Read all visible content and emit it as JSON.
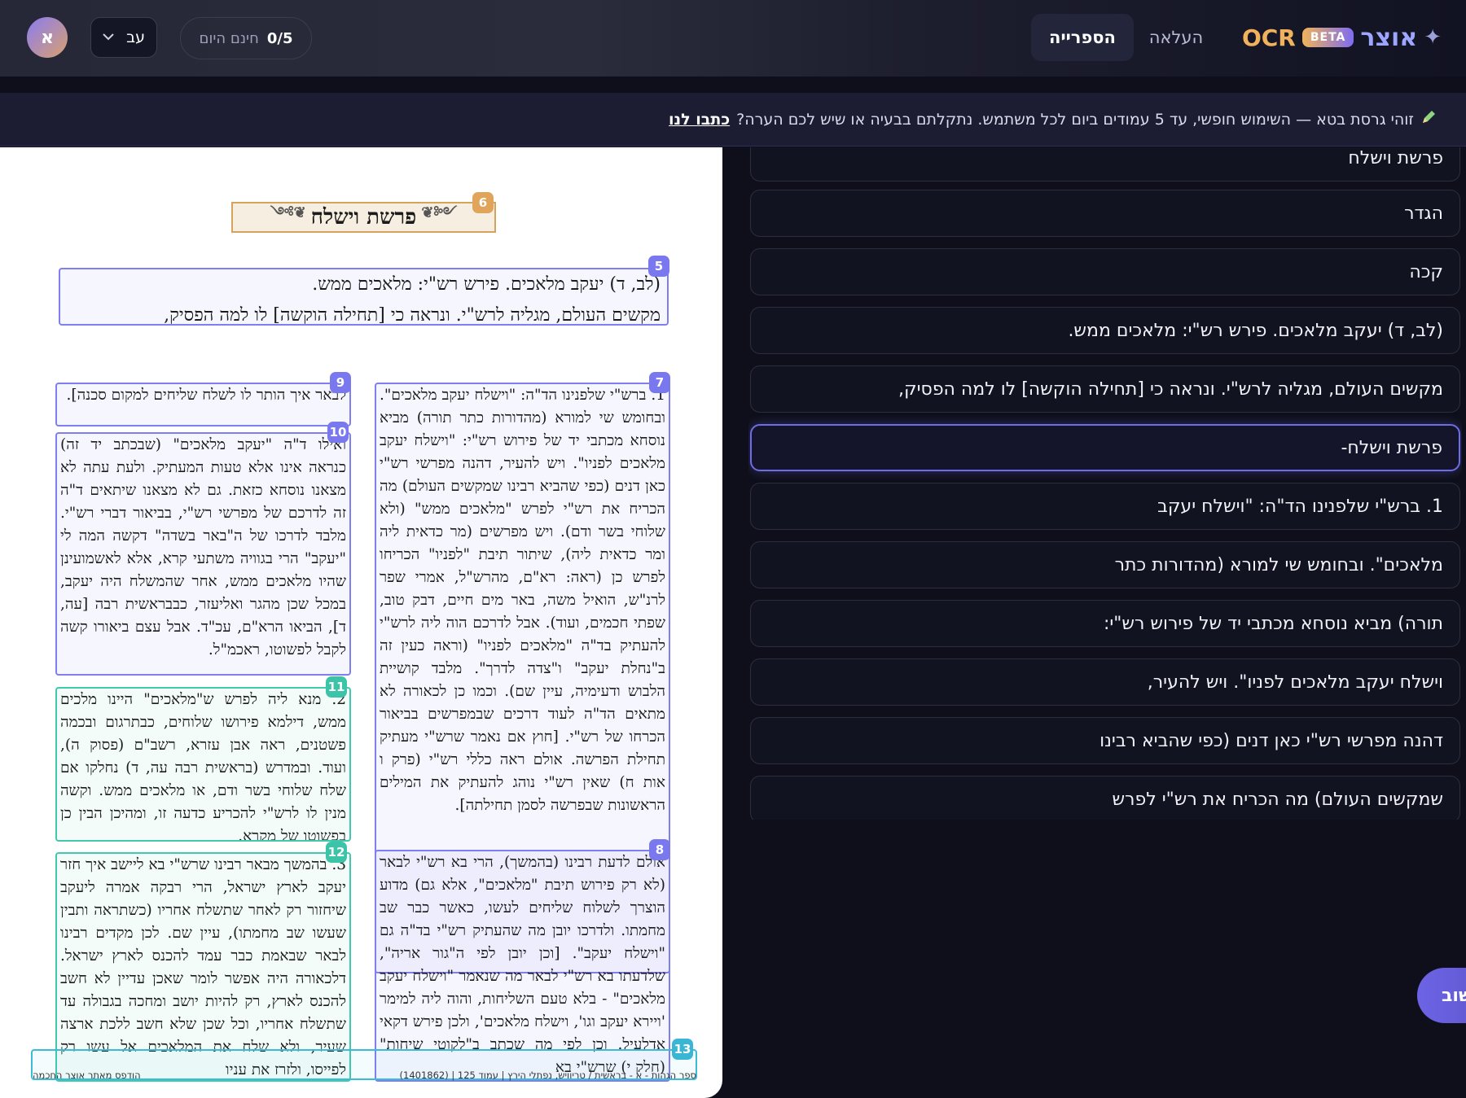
{
  "header": {
    "brand_spark": "✦",
    "brand_hebrew": "אוצר",
    "brand_beta": "BETA",
    "brand_ocr": "OCR",
    "tab_library": "הספרייה",
    "tab_upload": "העלאה",
    "quota_value": "0/5",
    "quota_label": "חינם היום",
    "language_value": "עב",
    "avatar_letter": "א"
  },
  "banner": {
    "text": "זוהי גרסת בטא — השימוש חופשי, עד 5 עמודים ביום לכל משתמש. נתקלתם בבעיה או שיש לכם הערה?",
    "link": "כתבו לנו"
  },
  "document": {
    "title": "פרשת וישלח",
    "intro_lines": [
      "(לב, ד) יעקב מלאכים. פירש רש\"י: מלאכים ממש.",
      "מקשים העולם, מגליה לרש\"י. ונראה כי [תחילה הוקשה] לו למה הפסיק,"
    ],
    "zones": {
      "z5": "5",
      "z6": "6",
      "z7": "7",
      "z8": "8",
      "z9": "9",
      "z10": "10",
      "z11": "11",
      "z12": "12",
      "z13": "13"
    },
    "col_right_top": "1. ברש\"י שלפנינו הד\"ה: \"וישלח יעקב מלאכים\". ובחומש שי למורא (מהדורות כתר תורה) מביא נוסחא מכתבי יד של פירוש רש\"י: \"וישלח יעקב מלאכים לפניו\". ויש להעיר, דהנה מפרשי רש\"י כאן דנים (כפי שהביא רבינו שמקשים העולם) מה הכריח את רש\"י לפרש \"מלאכים ממש\" (ולא שלוחי בשר ודם). ויש מפרשים (מר כדאית ליה ומר כדאית ליה), שיתור תיבת \"לפניו\" הכריחו לפרש כן (ראה: רא\"ם, מהרש\"ל, אמרי שפר לרנ\"ש, הואיל משה, באר מים חיים, דבק טוב, שפתי חכמים, ועוד). אבל לדרכם הוה ליה לרש\"י להעתיק בד\"ה \"מלאכים לפניו\" (וראה כעין זה ב\"נחלת יעקב\" ו\"צדה לדרך\". מלבד קושיית הלבוש ודעימיה, עיין שם). וכמו כן לכאורה לא מתאים הד\"ה לעוד דרכים שבמפרשים בביאור הכרחו של רש\"י. [חוץ אם נאמר שרש\"י מעתיק תחילת הפרשה. אולם ראה כללי רש\"י (פרק ו אות ח) שאין רש\"י נוהג להעתיק את המילים הראשונות שבפרשה לסמן תחילתה].",
    "col_right_bottom": "אולם לדעת רבינו (בהמשך), הרי בא רש\"י לבאר (לא רק פירוש תיבת \"מלאכים\", אלא גם) מדוע הוצרך לשלוח שליחים לעשו, כאשר כבר שב מחמתו. ולדרכו יובן מה שהעתיק רש\"י בד\"ה גם \"וישלח יעקב\". [וכן יובן לפי ה\"גור אריה\", שלדעתו בא רש\"י לבאר מה שנאמר \"וישלח יעקב מלאכים\" - בלא טעם השליחות, והוה ליה למימר 'ויירא יעקב וגו', וישלח מלאכים', ולכן פירש דקאי אדלעיל. וכן לפי מה שכתב ב\"לקוטי שיחות\" (חלק י) שרש\"י בא",
    "col_left_9": "לבאר איך הותר לו לשלח שליחים למקום סכנה].",
    "col_left_10": "ואילו ד\"ה \"יעקב מלאכים\" (שבכתב יד זה) כנראה אינו אלא טעות המעתיק. ולעת עתה לא מצאנו נוסחא כזאת. גם לא מצאנו שיתאים ד\"ה זה לדרכם של מפרשי רש\"י, בביאור דברי רש\"י. מלבד לדרכו של ה\"באר בשדה\" דקשה המה לי \"יעקב\" הרי בגוויה משתעי קרא, אלא לאשמועינן שהיו מלאכים ממש, אחר שהמשלח היה יעקב, במכל שכן מהגר ואליעזר, כבבראשית רבה [עה, ד], הביאו הרא\"ם, עכ\"ד. אבל עצם ביאורו קשה לקבל לפשוטו, ראכמ\"ל.",
    "col_left_11": "2. מנא ליה לפרש ש\"מלאכים\" היינו מלכים ממש, דילמא פירושו שלוחים, כבתרגום ובכמה פשטנים, ראה אבן עזרא, רשב\"ם (פסוק ה), ועוד. ובמדרש (בראשית רבה עה, ד) נחלקו אם שלח שלוחי בשר ודם, או מלאכים ממש. וקשה מנין לו לרש\"י להכריע כדעה זו, ומהיכן הבין כן בפשוטו של מקרא.",
    "col_left_12": "3. בהמשך מבאר רבינו שרש\"י בא ליישב איך חזר יעקב לארץ ישראל, הרי רבקה אמרה ליעקב שיחזור רק לאחר שתשלח אחריו (כשתראה ותבין שעשו שב מחמתו), עיין שם. לכן מקדים רבינו לבאר שבאמת כבר עמד להכנס לארץ ישראל. דלכאורה היה אפשר לומר שאכן עדיין לא חשב להכנס לארץ, רק להיות יושב ומחכה בגבולה עד שתשלח אחריו, וכל שכן שלא חשב ללכת ארצה שעיר, ולא שלח את המלאכים אל עשו רק לפייסו, ולזרז את עניו",
    "footer_right": "ספר הגהות - א - בראשית / טריוויש, נפתלי הירץ | עמוד 125 | (1401862)",
    "footer_left": "הודפס מאתר אוצר החכמה"
  },
  "panel": {
    "lines": [
      "פרשת וישלח",
      "הגדר",
      "קכה",
      "(לב, ד) יעקב מלאכים. פירש רש\"י: מלאכים ממש.",
      "מקשים העולם, מגליה לרש\"י. ונראה כי [תחילה הוקשה] לו למה הפסיק,",
      "פרשת וישלח-",
      "1. ברש\"י שלפנינו הד\"ה: \"וישלח יעקב",
      "מלאכים\". ובחומש שי למורא (מהדורות כתר",
      "תורה) מביא נוסחא מכתבי יד של פירוש רש\"י:",
      "וישלח יעקב מלאכים לפניו\". ויש להעיר,",
      "דהנה מפרשי רש\"י כאן דנים (כפי שהביא רבינו",
      "שמקשים העולם) מה הכריח את רש\"י לפרש"
    ],
    "selected_index": 5
  },
  "fab": {
    "label": "שוב"
  },
  "colors": {
    "accent": "#6f6ce8",
    "zone_purple": "#7f7ef2",
    "zone_teal": "#40c9ae",
    "zone_orange": "#e0a55a",
    "zone_cyan": "#38b6d4"
  }
}
